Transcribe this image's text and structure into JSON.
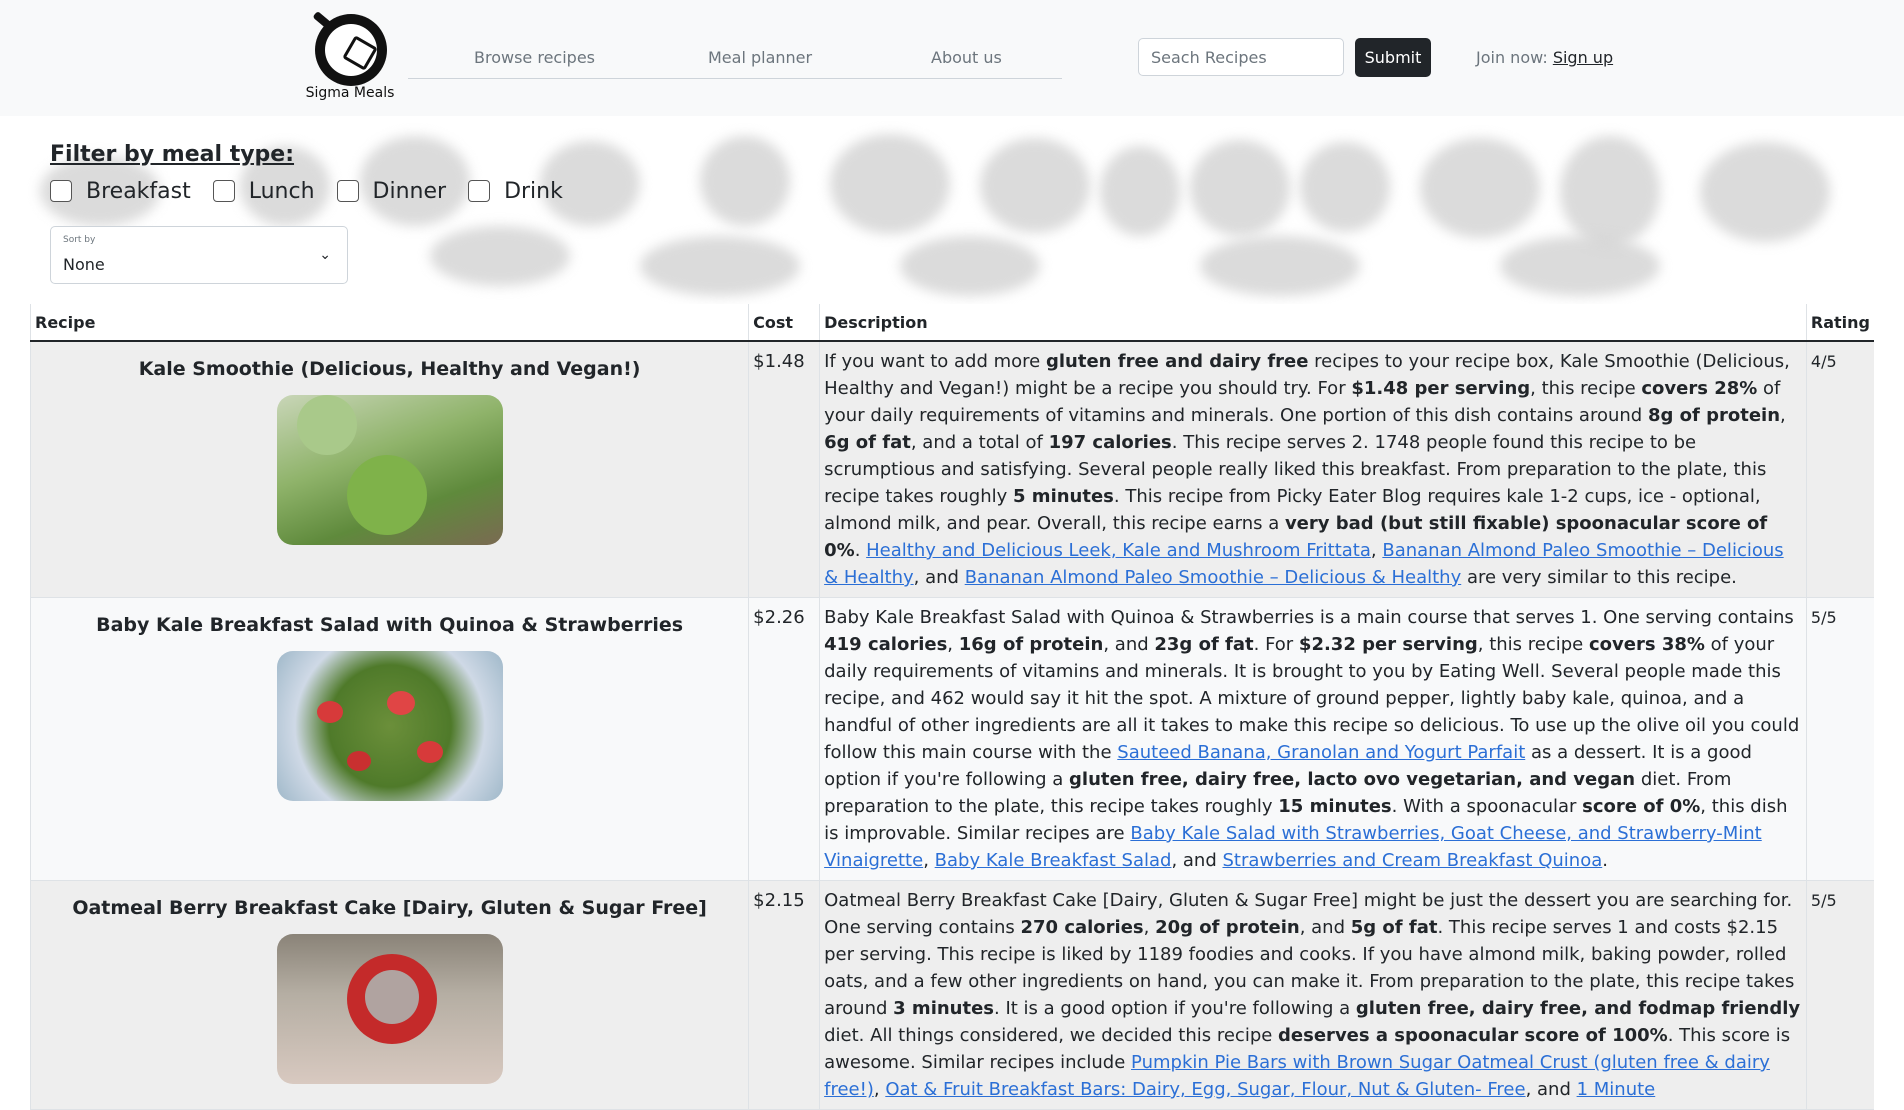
{
  "brand": {
    "name": "Sigma Meals"
  },
  "nav": {
    "links": [
      "Browse recipes",
      "Meal planner",
      "About us"
    ]
  },
  "search": {
    "placeholder": "Seach Recipes",
    "submit_label": "Submit"
  },
  "join": {
    "prefix": "Join now:",
    "link": "Sign up"
  },
  "filter": {
    "title": "Filter by meal type:",
    "options": [
      "Breakfast",
      "Lunch",
      "Dinner",
      "Drink"
    ]
  },
  "sort": {
    "label": "Sort by",
    "value": "None"
  },
  "table": {
    "headers": {
      "recipe": "Recipe",
      "cost": "Cost",
      "description": "Description",
      "rating": "Rating"
    },
    "rows": [
      {
        "name": "Kale Smoothie (Delicious, Healthy and Vegan!)",
        "cost": "$1.48",
        "rating": "4/5",
        "desc": [
          {
            "t": "If you want to add more "
          },
          {
            "b": "gluten free and dairy free"
          },
          {
            "t": " recipes to your recipe box, Kale Smoothie (Delicious, Healthy and Vegan!) might be a recipe you should try. For "
          },
          {
            "b": "$1.48 per serving"
          },
          {
            "t": ", this recipe "
          },
          {
            "b": "covers 28%"
          },
          {
            "t": " of your daily requirements of vitamins and minerals. One portion of this dish contains around "
          },
          {
            "b": "8g of protein"
          },
          {
            "t": ", "
          },
          {
            "b": "6g of fat"
          },
          {
            "t": ", and a total of "
          },
          {
            "b": "197 calories"
          },
          {
            "t": ". This recipe serves 2. 1748 people found this recipe to be scrumptious and satisfying. Several people really liked this breakfast. From preparation to the plate, this recipe takes roughly "
          },
          {
            "b": "5 minutes"
          },
          {
            "t": ". This recipe from Picky Eater Blog requires kale 1-2 cups, ice - optional, almond milk, and pear. Overall, this recipe earns a "
          },
          {
            "b": "very bad (but still fixable) spoonacular score of 0%"
          },
          {
            "t": ". "
          },
          {
            "a": "Healthy and Delicious Leek, Kale and Mushroom Frittata"
          },
          {
            "t": ", "
          },
          {
            "a": "Bananan Almond Paleo Smoothie – Delicious & Healthy"
          },
          {
            "t": ", and "
          },
          {
            "a": "Bananan Almond Paleo Smoothie – Delicious & Healthy"
          },
          {
            "t": " are very similar to this recipe."
          }
        ]
      },
      {
        "name": "Baby Kale Breakfast Salad with Quinoa & Strawberries",
        "cost": "$2.26",
        "rating": "5/5",
        "desc": [
          {
            "t": "Baby Kale Breakfast Salad with Quinoa & Strawberries is a main course that serves 1. One serving contains "
          },
          {
            "b": "419 calories"
          },
          {
            "t": ", "
          },
          {
            "b": "16g of protein"
          },
          {
            "t": ", and "
          },
          {
            "b": "23g of fat"
          },
          {
            "t": ". For "
          },
          {
            "b": "$2.32 per serving"
          },
          {
            "t": ", this recipe "
          },
          {
            "b": "covers 38%"
          },
          {
            "t": " of your daily requirements of vitamins and minerals. It is brought to you by Eating Well. Several people made this recipe, and 462 would say it hit the spot. A mixture of ground pepper, lightly baby kale, quinoa, and a handful of other ingredients are all it takes to make this recipe so delicious. To use up the olive oil you could follow this main course with the "
          },
          {
            "a": "Sauteed Banana, Granolan and Yogurt Parfait"
          },
          {
            "t": " as a dessert. It is a good option if you're following a "
          },
          {
            "b": "gluten free, dairy free, lacto ovo vegetarian, and vegan"
          },
          {
            "t": " diet. From preparation to the plate, this recipe takes roughly "
          },
          {
            "b": "15 minutes"
          },
          {
            "t": ". With a spoonacular "
          },
          {
            "b": "score of 0%"
          },
          {
            "t": ", this dish is improvable. Similar recipes are "
          },
          {
            "a": "Baby Kale Salad with Strawberries, Goat Cheese, and Strawberry-Mint Vinaigrette"
          },
          {
            "t": ", "
          },
          {
            "a": "Baby Kale Breakfast Salad"
          },
          {
            "t": ", and "
          },
          {
            "a": "Strawberries and Cream Breakfast Quinoa"
          },
          {
            "t": "."
          }
        ]
      },
      {
        "name": "Oatmeal Berry Breakfast Cake [Dairy, Gluten & Sugar Free]",
        "cost": "$2.15",
        "rating": "5/5",
        "desc": [
          {
            "t": "Oatmeal Berry Breakfast Cake [Dairy, Gluten & Sugar Free] might be just the dessert you are searching for. One serving contains "
          },
          {
            "b": "270 calories"
          },
          {
            "t": ", "
          },
          {
            "b": "20g of protein"
          },
          {
            "t": ", and "
          },
          {
            "b": "5g of fat"
          },
          {
            "t": ". This recipe serves 1 and costs $2.15 per serving. This recipe is liked by 1189 foodies and cooks. If you have almond milk, baking powder, rolled oats, and a few other ingredients on hand, you can make it. From preparation to the plate, this recipe takes around "
          },
          {
            "b": "3 minutes"
          },
          {
            "t": ". It is a good option if you're following a "
          },
          {
            "b": "gluten free, dairy free, and fodmap friendly"
          },
          {
            "t": " diet. All things considered, we decided this recipe "
          },
          {
            "b": "deserves a spoonacular score of 100%"
          },
          {
            "t": ". This score is awesome. Similar recipes include "
          },
          {
            "a": "Pumpkin Pie Bars with Brown Sugar Oatmeal Crust (gluten free & dairy free!)"
          },
          {
            "t": ", "
          },
          {
            "a": "Oat & Fruit Breakfast Bars: Dairy, Egg, Sugar, Flour, Nut & Gluten- Free"
          },
          {
            "t": ", and "
          },
          {
            "a": "1 Minute"
          }
        ]
      }
    ]
  },
  "colors": {
    "navbar_bg": "#f8f9fa",
    "button_dark": "#212529",
    "link_blue": "#2b6fd6",
    "row_shade": "#eeeeee"
  }
}
